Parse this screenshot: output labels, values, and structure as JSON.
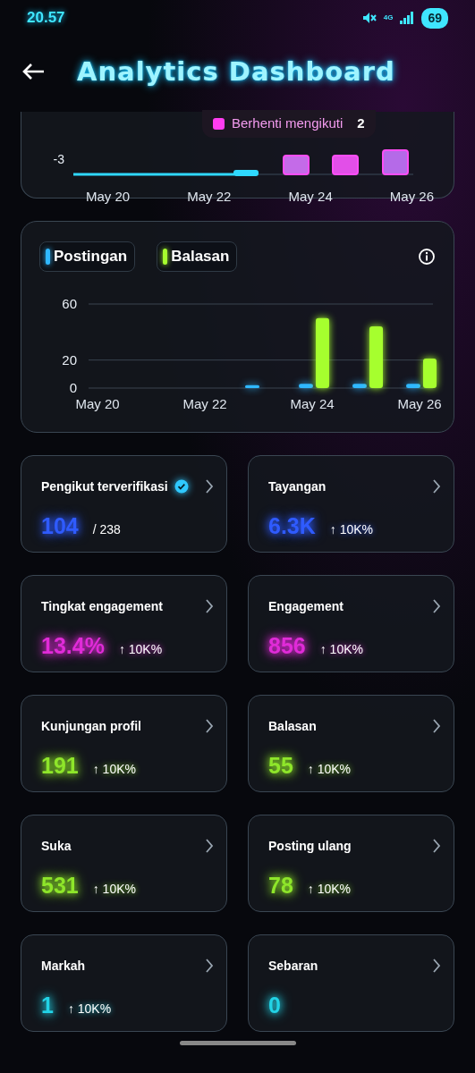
{
  "status_bar": {
    "time": "20.57",
    "network": "4G",
    "battery": "69"
  },
  "header": {
    "title": "Analytics Dashboard"
  },
  "top_chart": {
    "y_tick": "-3",
    "x_labels": [
      "May 20",
      "May 22",
      "May 24",
      "May 26"
    ],
    "tooltip": {
      "label": "Berhenti mengikuti",
      "value": "2",
      "color": "#ff3df0"
    }
  },
  "activity_chart": {
    "chart_data": {
      "type": "bar",
      "categories": [
        "May 20",
        null,
        "May 22",
        null,
        "May 24",
        null,
        "May 26"
      ],
      "yticks": [
        0,
        20,
        60
      ],
      "ylim": [
        0,
        60
      ],
      "series": [
        {
          "name": "Postingan",
          "color": "#2fb8ff",
          "values": [
            null,
            null,
            null,
            2,
            3,
            3,
            3
          ]
        },
        {
          "name": "Balasan",
          "color": "#a6ff2e",
          "values": [
            null,
            null,
            null,
            null,
            50,
            44,
            21
          ]
        }
      ]
    }
  },
  "metrics": [
    {
      "title": "Pengikut terverifikasi",
      "verified": true,
      "value": "104",
      "detail": "/ 238",
      "kind": "ratio",
      "color": "#2f5bff"
    },
    {
      "title": "Tayangan",
      "verified": false,
      "value": "6.3K",
      "detail": "↑ 10K%",
      "kind": "change",
      "color": "#2f5bff"
    },
    {
      "title": "Tingkat engagement",
      "verified": false,
      "value": "13.4%",
      "detail": "↑ 10K%",
      "kind": "change",
      "color": "#e02bd8"
    },
    {
      "title": "Engagement",
      "verified": false,
      "value": "856",
      "detail": "↑ 10K%",
      "kind": "change",
      "color": "#e02bd8"
    },
    {
      "title": "Kunjungan profil",
      "verified": false,
      "value": "191",
      "detail": "↑ 10K%",
      "kind": "change",
      "color": "#8ee62a"
    },
    {
      "title": "Balasan",
      "verified": false,
      "value": "55",
      "detail": "↑ 10K%",
      "kind": "change",
      "color": "#8ee62a"
    },
    {
      "title": "Suka",
      "verified": false,
      "value": "531",
      "detail": "↑ 10K%",
      "kind": "change",
      "color": "#8ee62a"
    },
    {
      "title": "Posting ulang",
      "verified": false,
      "value": "78",
      "detail": "↑ 10K%",
      "kind": "change",
      "color": "#8ee62a"
    },
    {
      "title": "Markah",
      "verified": false,
      "value": "1",
      "detail": "↑ 10K%",
      "kind": "change",
      "color": "#22d3e6"
    },
    {
      "title": "Sebaran",
      "verified": false,
      "value": "0",
      "kind": "plain",
      "color": "#22d3e6"
    }
  ]
}
